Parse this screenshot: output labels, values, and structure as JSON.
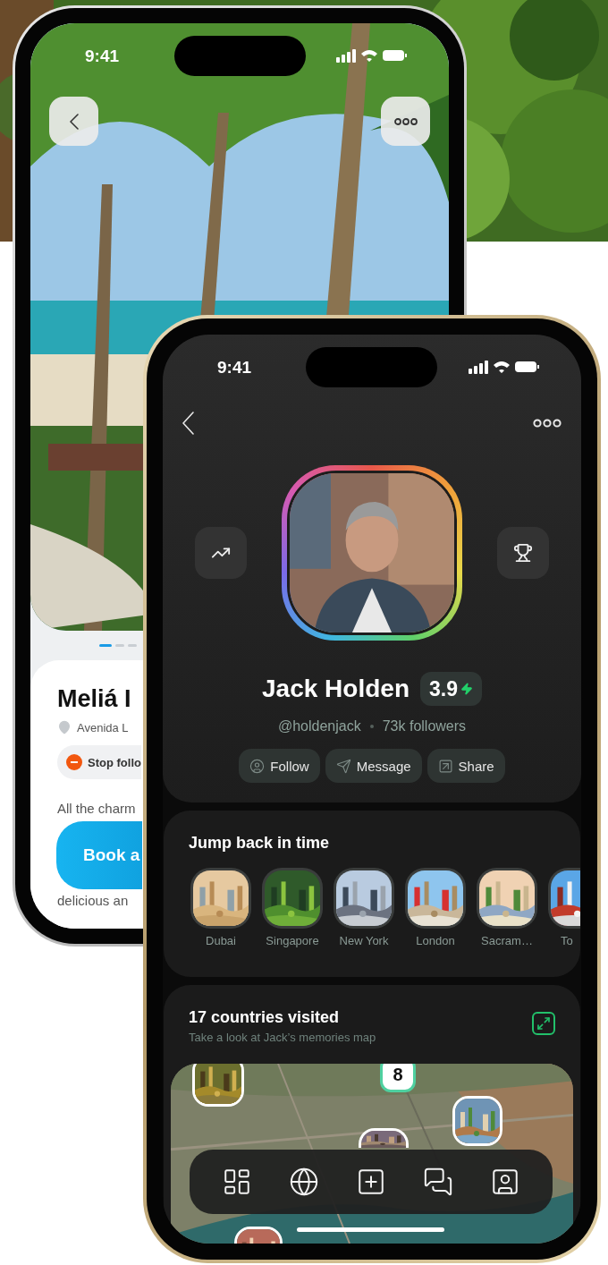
{
  "back_phone": {
    "status_bar": {
      "time": "9:41"
    },
    "page_dots": [
      {
        "selected": true
      },
      {
        "selected": false
      },
      {
        "selected": false
      }
    ],
    "hotel": {
      "title": "Meliá I",
      "address": "Avenida L",
      "chip": "Stop follo",
      "description": "All the charm",
      "cta": "Book a",
      "description_end": "delicious an"
    }
  },
  "front_phone": {
    "status_bar": {
      "time": "9:41"
    },
    "profile": {
      "name": "Jack Holden",
      "rating": "3.9",
      "handle": "@holdenjack",
      "followers": "73k followers",
      "actions": [
        {
          "label": "Follow"
        },
        {
          "label": "Message"
        },
        {
          "label": "Share"
        }
      ]
    },
    "memories": {
      "title": "Jump back in time",
      "places": [
        {
          "name": "Dubai"
        },
        {
          "name": "Singapore"
        },
        {
          "name": "New York"
        },
        {
          "name": "London"
        },
        {
          "name": "Sacram…"
        },
        {
          "name": "To"
        }
      ]
    },
    "countries": {
      "title": "17 countries visited",
      "subtitle": "Take a look at Jack’s memories map",
      "map_badge": "8"
    }
  }
}
